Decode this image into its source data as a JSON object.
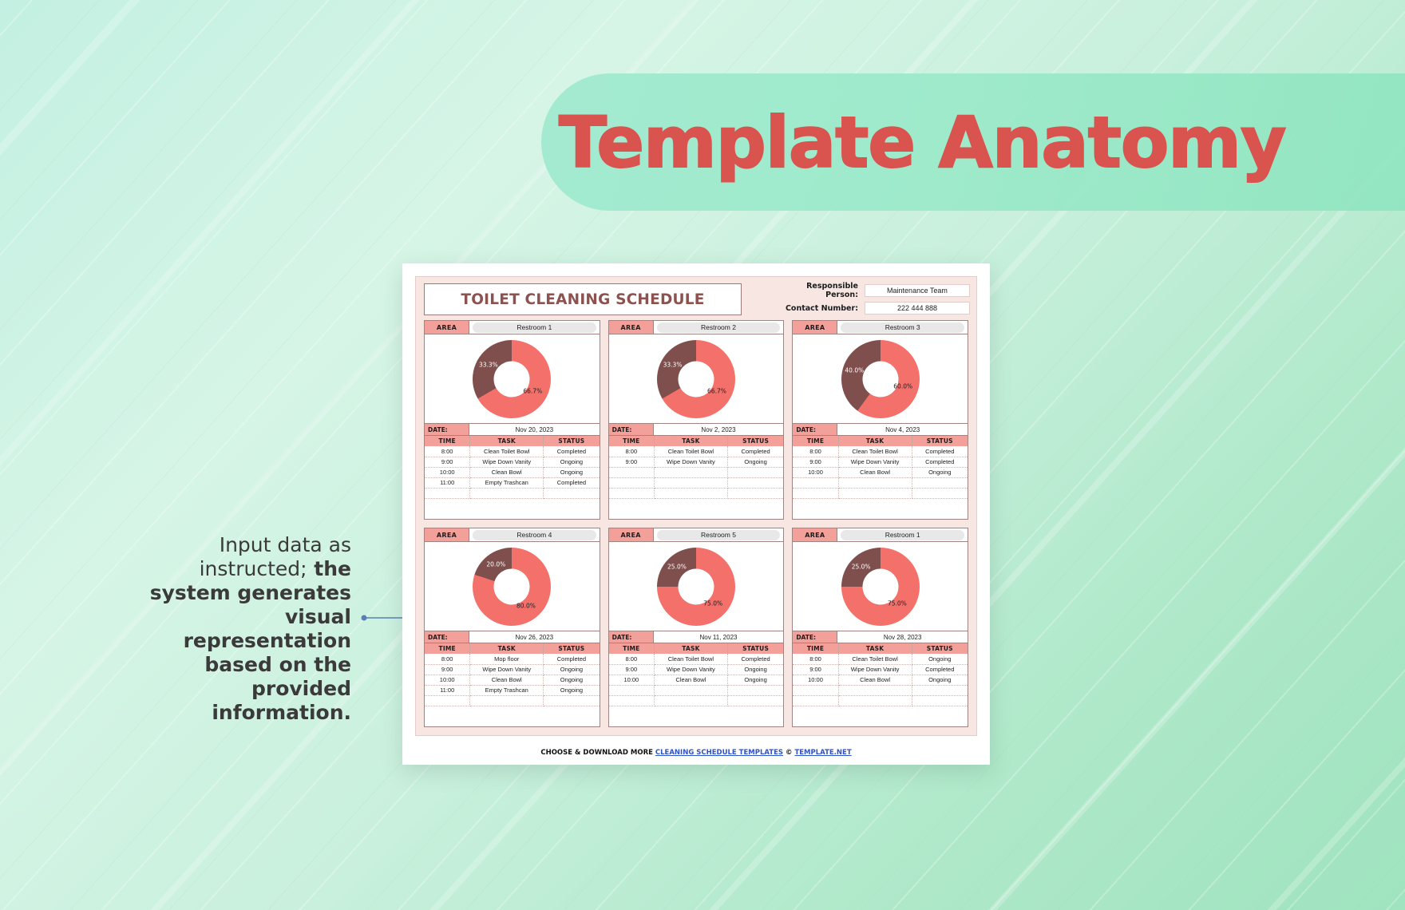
{
  "banner": {
    "title": "Template Anatomy"
  },
  "annotation": {
    "plain": "Input data as instructed;",
    "bold": " the system generates visual representation based on the provided information."
  },
  "document": {
    "title": "TOILET CLEANING SCHEDULE",
    "meta": [
      {
        "label": "Responsible Person:",
        "value": "Maintenance Team"
      },
      {
        "label": "Contact Number:",
        "value": "222 444 888"
      }
    ],
    "labels": {
      "area": "AREA",
      "date": "DATE:",
      "time_header": "TIME",
      "task_header": "TASK",
      "status_header": "STATUS"
    },
    "cards": [
      {
        "area": "Restroom 1",
        "date": "Nov 20, 2023",
        "chart_data": {
          "type": "pie",
          "categories": [
            "Completed",
            "Ongoing"
          ],
          "values": [
            66.7,
            33.3
          ],
          "labels": [
            "66.7%",
            "33.3%"
          ],
          "colors": [
            "#f4706a",
            "#7e4f4c"
          ],
          "title": ""
        },
        "rows": [
          {
            "time": "8:00",
            "task": "Clean Toilet Bowl",
            "status": "Completed"
          },
          {
            "time": "9:00",
            "task": "Wipe Down Vanity",
            "status": "Ongoing"
          },
          {
            "time": "10:00",
            "task": "Clean Bowl",
            "status": "Ongoing"
          },
          {
            "time": "11:00",
            "task": "Empty Trashcan",
            "status": "Completed"
          }
        ]
      },
      {
        "area": "Restroom 2",
        "date": "Nov 2, 2023",
        "chart_data": {
          "type": "pie",
          "categories": [
            "Completed",
            "Ongoing"
          ],
          "values": [
            66.7,
            33.3
          ],
          "labels": [
            "66.7%",
            "33.3%"
          ],
          "colors": [
            "#f4706a",
            "#7e4f4c"
          ],
          "title": ""
        },
        "rows": [
          {
            "time": "8:00",
            "task": "Clean Toilet Bowl",
            "status": "Completed"
          },
          {
            "time": "9:00",
            "task": "Wipe Down Vanity",
            "status": "Ongoing"
          }
        ]
      },
      {
        "area": "Restroom 3",
        "date": "Nov 4, 2023",
        "chart_data": {
          "type": "pie",
          "categories": [
            "Completed",
            "Ongoing"
          ],
          "values": [
            60.0,
            40.0
          ],
          "labels": [
            "60.0%",
            "40.0%"
          ],
          "colors": [
            "#f4706a",
            "#7e4f4c"
          ],
          "title": ""
        },
        "rows": [
          {
            "time": "8:00",
            "task": "Clean Toilet Bowl",
            "status": "Completed"
          },
          {
            "time": "9:00",
            "task": "Wipe Down Vanity",
            "status": "Completed"
          },
          {
            "time": "10:00",
            "task": "Clean Bowl",
            "status": "Ongoing"
          }
        ]
      },
      {
        "area": "Restroom 4",
        "date": "Nov 26, 2023",
        "chart_data": {
          "type": "pie",
          "categories": [
            "Completed",
            "Ongoing"
          ],
          "values": [
            80.0,
            20.0
          ],
          "labels": [
            "80.0%",
            "20.0%"
          ],
          "colors": [
            "#f4706a",
            "#7e4f4c"
          ],
          "title": ""
        },
        "rows": [
          {
            "time": "8:00",
            "task": "Mop floor",
            "status": "Completed"
          },
          {
            "time": "9:00",
            "task": "Wipe Down Vanity",
            "status": "Ongoing"
          },
          {
            "time": "10:00",
            "task": "Clean Bowl",
            "status": "Ongoing"
          },
          {
            "time": "11:00",
            "task": "Empty Trashcan",
            "status": "Ongoing"
          }
        ]
      },
      {
        "area": "Restroom 5",
        "date": "Nov 11, 2023",
        "chart_data": {
          "type": "pie",
          "categories": [
            "Completed",
            "Ongoing"
          ],
          "values": [
            75.0,
            25.0
          ],
          "labels": [
            "75.0%",
            "25.0%"
          ],
          "colors": [
            "#f4706a",
            "#7e4f4c"
          ],
          "title": ""
        },
        "rows": [
          {
            "time": "8:00",
            "task": "Clean Toilet Bowl",
            "status": "Completed"
          },
          {
            "time": "9:00",
            "task": "Wipe Down Vanity",
            "status": "Ongoing"
          },
          {
            "time": "10:00",
            "task": "Clean Bowl",
            "status": "Ongoing"
          }
        ]
      },
      {
        "area": "Restroom 1",
        "date": "Nov 28, 2023",
        "chart_data": {
          "type": "pie",
          "categories": [
            "Completed",
            "Ongoing"
          ],
          "values": [
            75.0,
            25.0
          ],
          "labels": [
            "75.0%",
            "25.0%"
          ],
          "colors": [
            "#f4706a",
            "#7e4f4c"
          ],
          "title": ""
        },
        "rows": [
          {
            "time": "8:00",
            "task": "Clean Toilet Bowl",
            "status": "Ongoing"
          },
          {
            "time": "9:00",
            "task": "Wipe Down Vanity",
            "status": "Completed"
          },
          {
            "time": "10:00",
            "task": "Clean Bowl",
            "status": "Ongoing"
          }
        ]
      }
    ],
    "footer": {
      "prefix": "CHOOSE & DOWNLOAD MORE ",
      "link1": "CLEANING SCHEDULE TEMPLATES",
      "copy": " © ",
      "link2": "TEMPLATE.NET"
    }
  },
  "colors": {
    "accent_red": "#d9534f",
    "chart_primary": "#f4706a",
    "chart_secondary": "#7e4f4c",
    "header_pink": "#f4a09a",
    "panel_bg": "#f7e6e2"
  },
  "chart_data": [
    {
      "type": "pie",
      "title": "Restroom 1 - Nov 20, 2023",
      "categories": [
        "Completed",
        "Ongoing"
      ],
      "values": [
        66.7,
        33.3
      ]
    },
    {
      "type": "pie",
      "title": "Restroom 2 - Nov 2, 2023",
      "categories": [
        "Completed",
        "Ongoing"
      ],
      "values": [
        66.7,
        33.3
      ]
    },
    {
      "type": "pie",
      "title": "Restroom 3 - Nov 4, 2023",
      "categories": [
        "Completed",
        "Ongoing"
      ],
      "values": [
        60.0,
        40.0
      ]
    },
    {
      "type": "pie",
      "title": "Restroom 4 - Nov 26, 2023",
      "categories": [
        "Completed",
        "Ongoing"
      ],
      "values": [
        80.0,
        20.0
      ]
    },
    {
      "type": "pie",
      "title": "Restroom 5 - Nov 11, 2023",
      "categories": [
        "Completed",
        "Ongoing"
      ],
      "values": [
        75.0,
        25.0
      ]
    },
    {
      "type": "pie",
      "title": "Restroom 1 - Nov 28, 2023",
      "categories": [
        "Completed",
        "Ongoing"
      ],
      "values": [
        75.0,
        25.0
      ]
    }
  ]
}
